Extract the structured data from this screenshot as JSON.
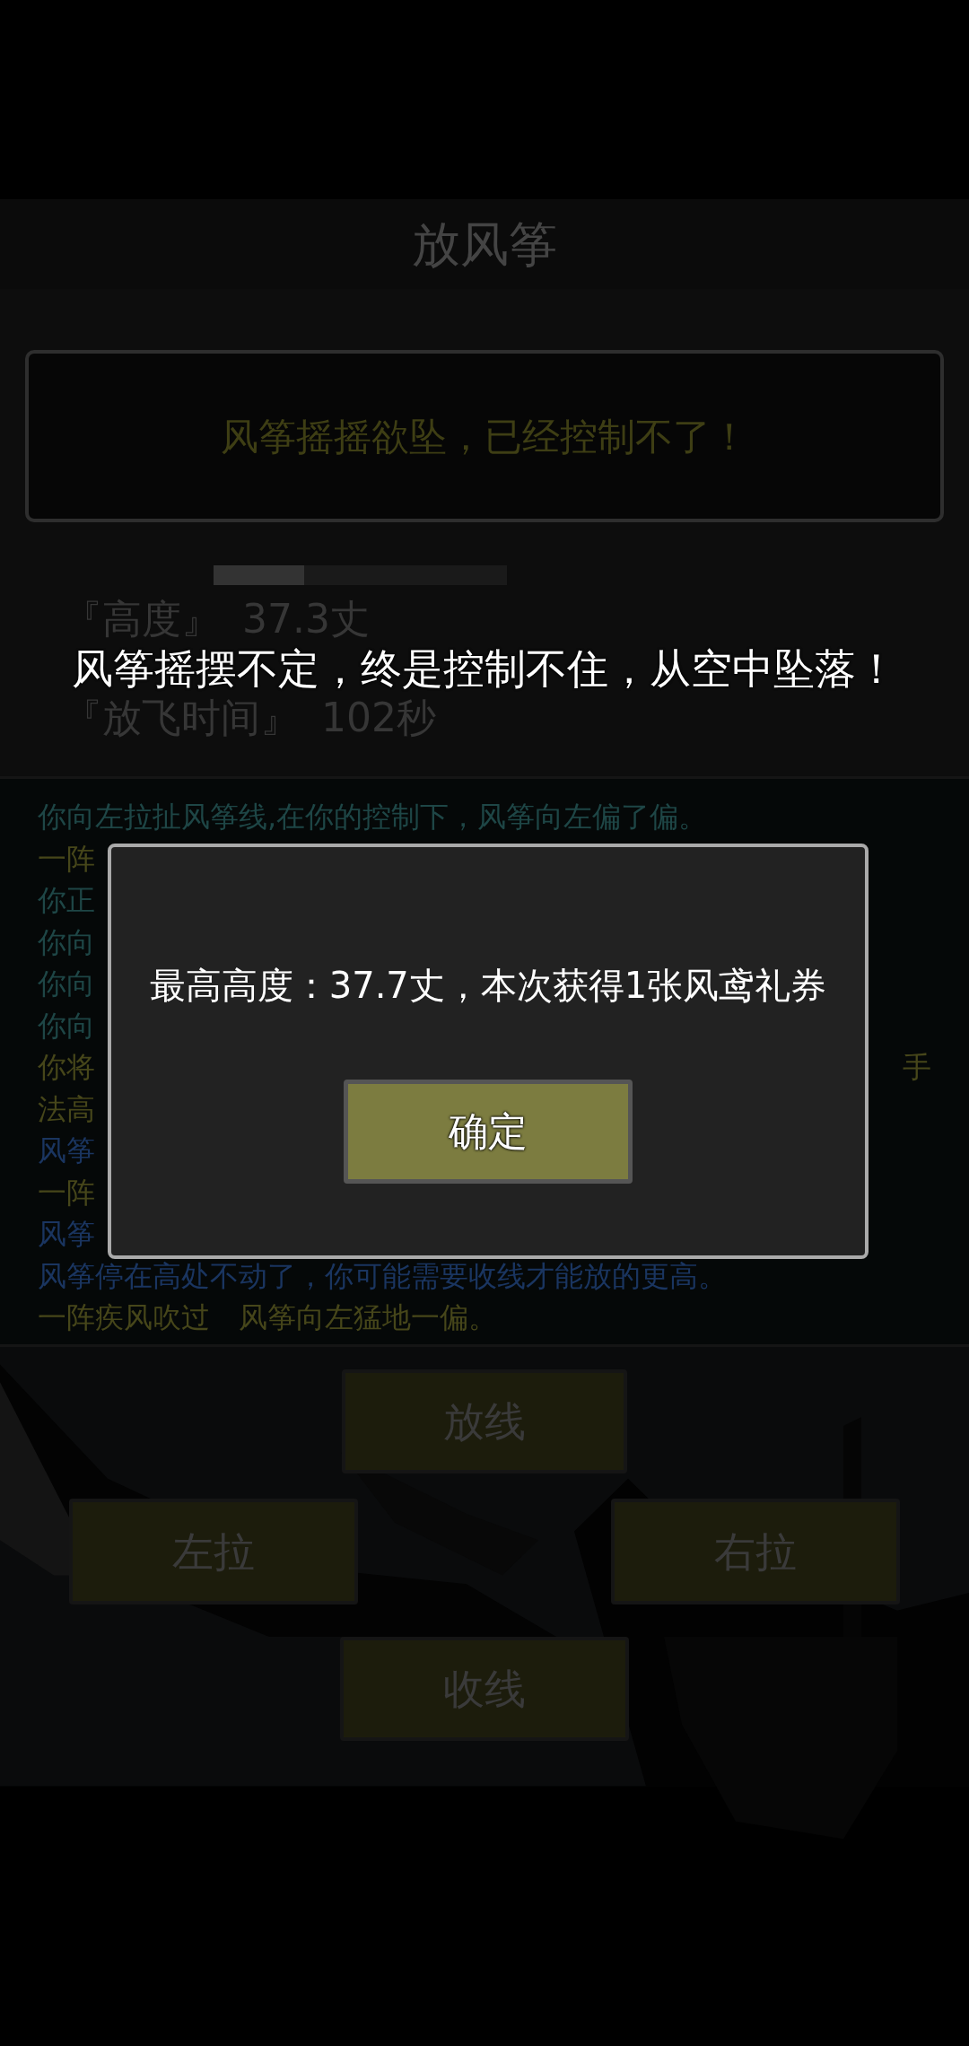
{
  "title": "放风筝",
  "status_message": "风筝摇摇欲坠，已经控制不了！",
  "progress": {
    "level": 0.31
  },
  "stats": [
    {
      "label": "『高度』",
      "value": "37.3丈"
    },
    {
      "label": "『放飞时间』",
      "value": "102秒"
    }
  ],
  "toast": "风筝摇摆不定，终是控制不住，从空中坠落！",
  "log": [
    {
      "text": "你向左拉扯风筝线,在你的控制下，风筝向左偏了偏。",
      "color": "#1e4646"
    },
    {
      "text": "一阵",
      "color": "#46461a"
    },
    {
      "text": "你正",
      "color": "#1e4646"
    },
    {
      "text": "你向",
      "color": "#1e4646"
    },
    {
      "text": "你向",
      "color": "#1e4646"
    },
    {
      "text": "你向",
      "color": "#1e4646"
    },
    {
      "text": "你将",
      "tail": "手",
      "color": "#46461a"
    },
    {
      "text": "法高",
      "color": "#46461a"
    },
    {
      "text": "风筝",
      "color": "#1a3560"
    },
    {
      "text": "一阵",
      "color": "#46461a"
    },
    {
      "text": "风筝",
      "color": "#1a3560"
    },
    {
      "text": "风筝停在高处不动了，你可能需要收线才能放的更高。",
      "color": "#1a3560"
    },
    {
      "text": "一阵疾风吹过　风筝向左猛地一偏。",
      "color": "#46461a"
    }
  ],
  "controls": {
    "release": "放线",
    "left": "左拉",
    "right": "右拉",
    "reel": "收线"
  },
  "dialog": {
    "message": "最高高度：37.7丈，本次获得1张风鸢礼券",
    "button": "确定"
  }
}
